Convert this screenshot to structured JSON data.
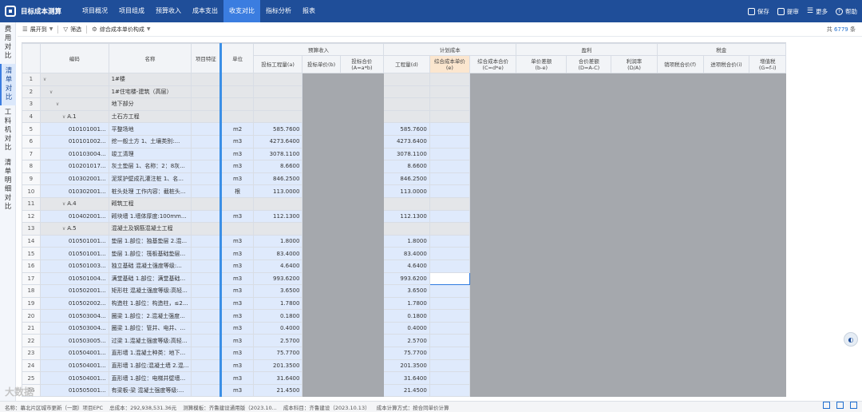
{
  "app": {
    "title": "目标成本测算"
  },
  "nav": [
    "项目概况",
    "项目组成",
    "预算收入",
    "成本支出",
    "收支对比",
    "指标分析",
    "报表"
  ],
  "nav_active": 4,
  "actions": [
    {
      "icon": "save-icon",
      "label": "保存"
    },
    {
      "icon": "submit-icon",
      "label": "提审"
    },
    {
      "icon": "more-icon",
      "label": "更多"
    },
    {
      "icon": "help-icon",
      "label": "帮助"
    }
  ],
  "side_tabs": [
    {
      "label": [
        "费",
        "用",
        "对",
        "比"
      ],
      "active": false
    },
    {
      "label": [
        "清",
        "单",
        "对",
        "比"
      ],
      "active": true
    },
    {
      "label": [
        "工",
        "料",
        "机",
        "对",
        "比"
      ],
      "active": false
    },
    {
      "label": [
        "清",
        "单",
        "明",
        "细",
        "对",
        "比"
      ],
      "active": false
    }
  ],
  "toolbar": {
    "expand": "展开到",
    "filter": "筛选",
    "composition": "综合成本单价构成",
    "total_prefix": "共",
    "total_count": "6779",
    "total_suffix": "条"
  },
  "headers": {
    "code": "编码",
    "name": "名称",
    "feature": "项目特征",
    "unit": "单位",
    "group_budget": "预算收入",
    "group_plan": "计划成本",
    "group_profit": "盈利",
    "group_tax": "税金",
    "sub": [
      "投标工程量(a)",
      "投标单价(b)",
      "投标合价\n(A=a*b)",
      "工程量(d)",
      "综合成本单价(e)",
      "综合成本合价\n(C=d*e)",
      "单价差额\n(b-e)",
      "合价差额\n(D=A-C)",
      "利润率\n(D/A)",
      "销项税合价(f)",
      "进项税合价(i)",
      "增值税\n(G=f-i)"
    ]
  },
  "rows": [
    {
      "n": "1",
      "indent": 0,
      "exp": "∨",
      "code": "",
      "name": "1#楼",
      "unit": "",
      "qty": "",
      "sec": true
    },
    {
      "n": "2",
      "indent": 1,
      "exp": "∨",
      "code": "",
      "name": "1#住宅楼-建筑（高层）",
      "unit": "",
      "qty": "",
      "sec": true
    },
    {
      "n": "3",
      "indent": 2,
      "exp": "∨",
      "code": "",
      "name": "地下部分",
      "unit": "",
      "qty": "",
      "sec": true
    },
    {
      "n": "4",
      "indent": 3,
      "exp": "∨",
      "code": "A.1",
      "name": "土石方工程",
      "unit": "",
      "qty": "",
      "sec": true
    },
    {
      "n": "5",
      "indent": 4,
      "exp": "",
      "code": "010101001...",
      "name": "平整场地",
      "unit": "m2",
      "qty": "585.7600",
      "sec": false
    },
    {
      "n": "6",
      "indent": 4,
      "exp": "",
      "code": "010101002...",
      "name": "挖一般土方 1、土壤类别:...",
      "unit": "m3",
      "qty": "4273.6400",
      "sec": false
    },
    {
      "n": "7",
      "indent": 4,
      "exp": "",
      "code": "010103004...",
      "name": "竣工清理",
      "unit": "m3",
      "qty": "3078.1100",
      "sec": false
    },
    {
      "n": "8",
      "indent": 4,
      "exp": "",
      "code": "010201017...",
      "name": "灰土垫层 1、名称：2：8灰...",
      "unit": "m3",
      "qty": "8.6600",
      "sec": false
    },
    {
      "n": "9",
      "indent": 4,
      "exp": "",
      "code": "010302001...",
      "name": "泥浆护壁成孔灌注桩 1、名...",
      "unit": "m3",
      "qty": "846.2500",
      "sec": false
    },
    {
      "n": "10",
      "indent": 4,
      "exp": "",
      "code": "010302001...",
      "name": "桩头处理 工作内容：截桩头...",
      "unit": "根",
      "qty": "113.0000",
      "sec": false
    },
    {
      "n": "11",
      "indent": 3,
      "exp": "∨",
      "code": "A.4",
      "name": "砌筑工程",
      "unit": "",
      "qty": "",
      "sec": true
    },
    {
      "n": "12",
      "indent": 4,
      "exp": "",
      "code": "010402001...",
      "name": "砌块墙 1.墙体厚度:100mm...",
      "unit": "m3",
      "qty": "112.1300",
      "sec": false
    },
    {
      "n": "13",
      "indent": 3,
      "exp": "∨",
      "code": "A.5",
      "name": "混凝土及钢筋混凝土工程",
      "unit": "",
      "qty": "",
      "sec": true
    },
    {
      "n": "14",
      "indent": 4,
      "exp": "",
      "code": "010501001...",
      "name": "垫层 1.部位：独基垫层 2.混...",
      "unit": "m3",
      "qty": "1.8000",
      "sec": false
    },
    {
      "n": "15",
      "indent": 4,
      "exp": "",
      "code": "010501001...",
      "name": "垫层 1.部位：筏板基础垫层...",
      "unit": "m3",
      "qty": "83.4000",
      "sec": false
    },
    {
      "n": "16",
      "indent": 4,
      "exp": "",
      "code": "010501003...",
      "name": "独立基础 混凝土强度等级:...",
      "unit": "m3",
      "qty": "4.6400",
      "sec": false
    },
    {
      "n": "17",
      "indent": 4,
      "exp": "",
      "code": "010501004...",
      "name": "满堂基础 1.部位：满堂基础...",
      "unit": "m3",
      "qty": "993.6200",
      "sec": false,
      "selected": true
    },
    {
      "n": "18",
      "indent": 4,
      "exp": "",
      "code": "010502001...",
      "name": "矩形柱 混凝土强度等级:高轻...",
      "unit": "m3",
      "qty": "3.6500",
      "sec": false
    },
    {
      "n": "19",
      "indent": 4,
      "exp": "",
      "code": "010502002...",
      "name": "构造柱 1.部位：构造柱，≤2...",
      "unit": "m3",
      "qty": "1.7800",
      "sec": false
    },
    {
      "n": "20",
      "indent": 4,
      "exp": "",
      "code": "010503004...",
      "name": "圈梁 1.部位：2.混凝土强度...",
      "unit": "m3",
      "qty": "0.1800",
      "sec": false
    },
    {
      "n": "21",
      "indent": 4,
      "exp": "",
      "code": "010503004...",
      "name": "圈梁 1.部位：管井、电井、...",
      "unit": "m3",
      "qty": "0.4000",
      "sec": false
    },
    {
      "n": "22",
      "indent": 4,
      "exp": "",
      "code": "010503005...",
      "name": "过梁 1.混凝土强度等级:高轻...",
      "unit": "m3",
      "qty": "2.5700",
      "sec": false
    },
    {
      "n": "23",
      "indent": 4,
      "exp": "",
      "code": "010504001...",
      "name": "直形墙 1.混凝土种类：地下...",
      "unit": "m3",
      "qty": "75.7700",
      "sec": false
    },
    {
      "n": "24",
      "indent": 4,
      "exp": "",
      "code": "010504001...",
      "name": "直形墙 1.部位:混凝土墙 2.混...",
      "unit": "m3",
      "qty": "201.3500",
      "sec": false
    },
    {
      "n": "25",
      "indent": 4,
      "exp": "",
      "code": "010504001...",
      "name": "直形墙 1.部位：电梯井壁墙...",
      "unit": "m3",
      "qty": "31.6400",
      "sec": false
    },
    {
      "n": "26",
      "indent": 4,
      "exp": "",
      "code": "010505001...",
      "name": "有梁板-梁 混凝土强度等级:...",
      "unit": "m3",
      "qty": "21.4500",
      "sec": false
    }
  ],
  "status": [
    "名称：幕北片区城市更新（一期）项目EPC",
    "总成本：292,938,531.36元",
    "测算模板：齐鲁建设通用版（2023.10...",
    "成本科目：齐鲁建设（2023.10.13）",
    "成本计算方式：按合同单价计算"
  ],
  "watermark": "大数据"
}
